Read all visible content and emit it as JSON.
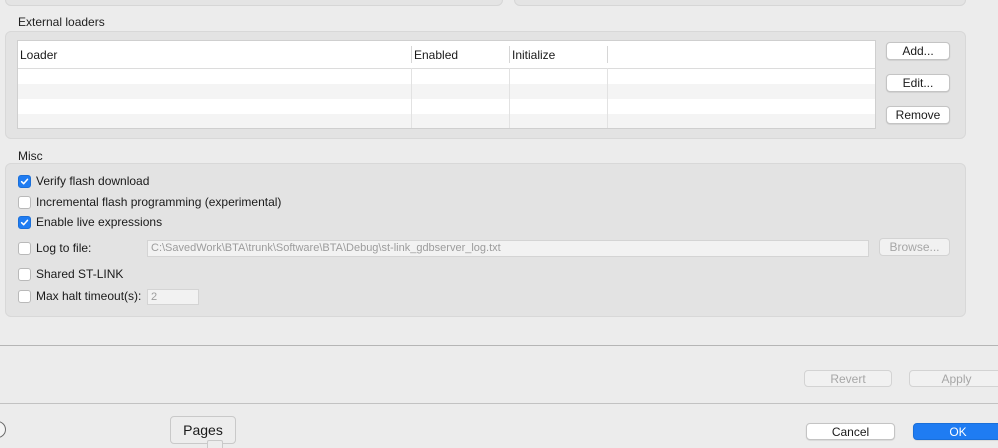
{
  "external_loaders": {
    "title": "External loaders",
    "columns": [
      "Loader",
      "Enabled",
      "Initialize"
    ],
    "rows": [],
    "buttons": {
      "add": "Add...",
      "edit": "Edit...",
      "remove": "Remove"
    }
  },
  "misc": {
    "title": "Misc",
    "verify_flash": {
      "label": "Verify flash download",
      "checked": true
    },
    "incremental_flash": {
      "label": "Incremental flash programming (experimental)",
      "checked": false
    },
    "live_expressions": {
      "label": "Enable live expressions",
      "checked": true
    },
    "log_to_file": {
      "label": "Log to file:",
      "checked": false,
      "path": "C:\\SavedWork\\BTA\\trunk\\Software\\BTA\\Debug\\st-link_gdbserver_log.txt",
      "browse": "Browse..."
    },
    "shared_stlink": {
      "label": "Shared ST-LINK",
      "checked": false
    },
    "max_halt": {
      "label": "Max halt timeout(s):",
      "checked": false,
      "value": "2"
    }
  },
  "footer": {
    "revert": "Revert",
    "apply": "Apply",
    "cancel": "Cancel",
    "ok": "OK",
    "pages_tab": "Pages"
  },
  "colors": {
    "accent": "#1f7cf2",
    "window_bg": "#ececec",
    "group_bg": "#e3e3e3"
  }
}
